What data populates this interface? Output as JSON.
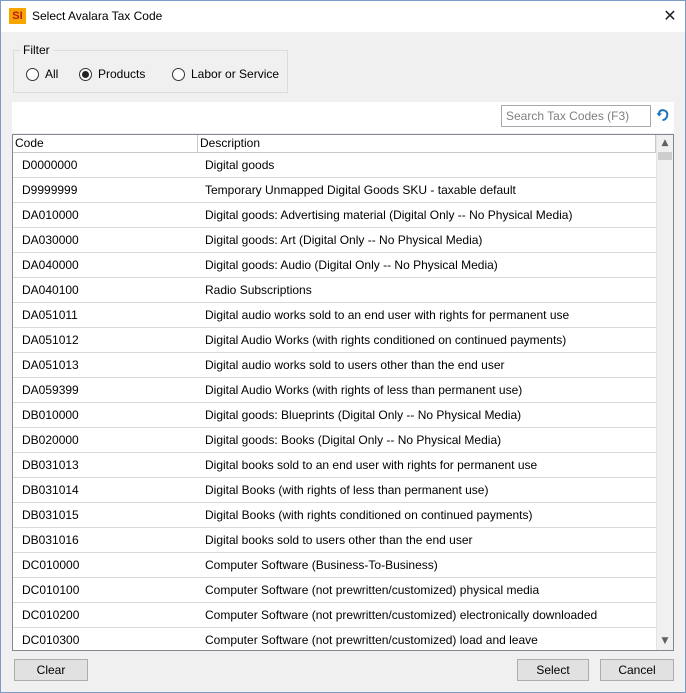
{
  "window": {
    "title": "Select Avalara Tax Code",
    "app_icon_text": "SI",
    "close_glyph": "✕"
  },
  "filter": {
    "legend": "Filter",
    "options": [
      {
        "label": "All",
        "checked": false
      },
      {
        "label": "Products",
        "checked": true
      },
      {
        "label": "Labor or Service",
        "checked": false
      }
    ]
  },
  "search": {
    "placeholder": "Search Tax Codes (F3)",
    "refresh_icon": "refresh-icon"
  },
  "grid": {
    "columns": [
      "Code",
      "Description"
    ],
    "rows": [
      {
        "code": "D0000000",
        "description": "Digital goods"
      },
      {
        "code": "D9999999",
        "description": "Temporary Unmapped Digital Goods SKU - taxable default"
      },
      {
        "code": "DA010000",
        "description": "Digital goods: Advertising material (Digital Only -- No Physical Media)"
      },
      {
        "code": "DA030000",
        "description": "Digital goods: Art (Digital Only -- No Physical Media)"
      },
      {
        "code": "DA040000",
        "description": "Digital goods: Audio (Digital Only -- No Physical Media)"
      },
      {
        "code": "DA040100",
        "description": "Radio Subscriptions"
      },
      {
        "code": "DA051011",
        "description": "Digital audio works sold to an end user with rights for permanent use"
      },
      {
        "code": "DA051012",
        "description": "Digital Audio Works (with rights conditioned on continued payments)"
      },
      {
        "code": "DA051013",
        "description": "Digital audio works sold to users other than the end user"
      },
      {
        "code": "DA059399",
        "description": "Digital Audio Works (with rights of less than permanent use)"
      },
      {
        "code": "DB010000",
        "description": "Digital goods: Blueprints (Digital Only -- No Physical Media)"
      },
      {
        "code": "DB020000",
        "description": "Digital goods: Books (Digital Only -- No Physical Media)"
      },
      {
        "code": "DB031013",
        "description": "Digital books sold to an end user with rights for permanent use"
      },
      {
        "code": "DB031014",
        "description": "Digital Books (with rights of less than permanent use)"
      },
      {
        "code": "DB031015",
        "description": "Digital Books (with rights conditioned on continued payments)"
      },
      {
        "code": "DB031016",
        "description": "Digital books sold to users other than the end user"
      },
      {
        "code": "DC010000",
        "description": "Computer Software (Business-To-Business)"
      },
      {
        "code": "DC010100",
        "description": "Computer Software (not prewritten/customized) physical media"
      },
      {
        "code": "DC010200",
        "description": "Computer Software (not prewritten/customized) electronically downloaded"
      },
      {
        "code": "DC010300",
        "description": "Computer Software (not prewritten/customized) load and leave"
      }
    ]
  },
  "buttons": {
    "clear": "Clear",
    "select": "Select",
    "cancel": "Cancel"
  },
  "colors": {
    "accent": "#1e73be",
    "window_border": "#7a9cc7",
    "app_icon_bg": "#f7a600",
    "app_icon_fg": "#c0161b"
  }
}
